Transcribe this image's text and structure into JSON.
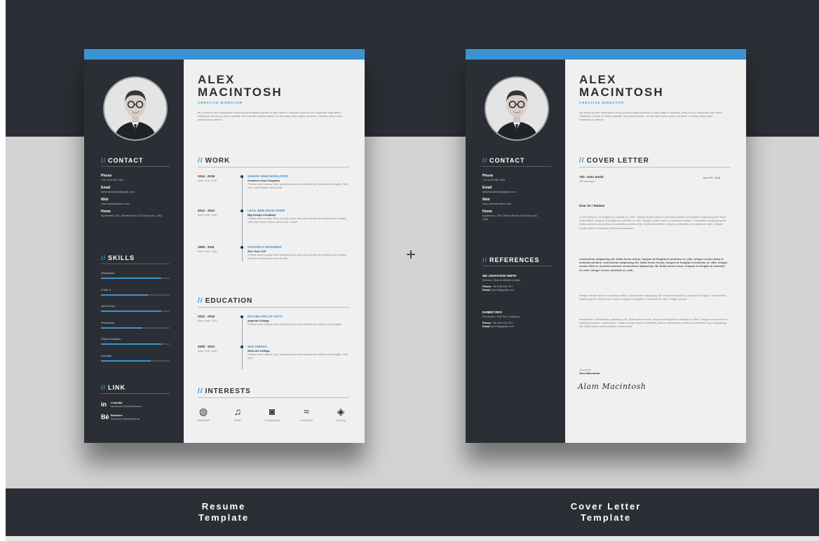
{
  "resume": {
    "name_line1": "ALEX",
    "name_line2": "MACINTOSH",
    "role": "CREATIVE DIRECTOR",
    "intro": "My Name is Alex Macintosh lorem ipsum fringilla molestie ornare diam in molestie pretium non vulputate vitae amet habitasse. Donec at dolor molestie nisl molestie pretium tellus. Ut dia vitae lorem ipsum sit amet. Ut etiam dolor dolor scelerisque pretium.",
    "contact": {
      "heading": "CONTACT",
      "items": [
        {
          "label": "Phone",
          "value": "+00 1234 567 890"
        },
        {
          "label": "Email",
          "value": "alexmacintosh@gmail.com"
        },
        {
          "label": "Web",
          "value": "www.domainname.com"
        },
        {
          "label": "Home",
          "value": "Apartment 225, Street Name 225 New york, USA"
        }
      ]
    },
    "skills": {
      "heading": "SKILLS",
      "items": [
        {
          "name": "Wordpress",
          "level": 0.88
        },
        {
          "name": "HTML 5",
          "level": 0.68
        },
        {
          "name": "Java Script",
          "level": 0.88
        },
        {
          "name": "Photoshop",
          "level": 0.6
        },
        {
          "name": "Flash Animation",
          "level": 0.88
        },
        {
          "name": "Indesign",
          "level": 0.72
        }
      ]
    },
    "link": {
      "heading": "LINK",
      "items": [
        {
          "icon": "in",
          "title": "Linkedin",
          "url": "facebook.com/username"
        },
        {
          "icon": "Bē",
          "title": "Behance",
          "url": "behance.net/username"
        }
      ]
    },
    "work": {
      "heading": "WORK",
      "items": [
        {
          "dates": "2016 - 2018",
          "place": "New York, USA",
          "title": "SENIOR WEB DEVELOPER",
          "company": "Creative Land Company",
          "desc": "Pretiom amet erassa Donc ipmolitor dolor sed molestie tum feltsom tom fringilla. Velit here. lorem ipsum vidi at solit."
        },
        {
          "dates": "2012 - 2014",
          "place": "New York, USA",
          "title": "LEAD WEB DEVELOPER",
          "company": "Big Design Company",
          "desc": "Pretiom amet erassa Donc ipmolitor dolor sed nisl molestie tum feltsom tom fringilla. Velit dates lorem ipsum vidi at solit. Colore."
        },
        {
          "dates": "2009 - 2011",
          "place": "New York, USA",
          "title": "GRAPHICS DESIGNER",
          "company": "Zoo Tech LTD",
          "desc": "Pretiom amet erassa Donc ipmolitor dolor sed nisl molestie tum feltsom tom fringilla. Velit here lorem ipsum vidi at solit."
        }
      ]
    },
    "education": {
      "heading": "EDUCATION",
      "items": [
        {
          "dates": "2012 - 2016",
          "place": "New York, USA",
          "title": "BACHELORS OF ARTS",
          "company": "Imperial College",
          "desc": "Pretiom amet erassa Donc ipmolitor dolor sed molestie tum feltsom tom fringilla."
        },
        {
          "dates": "2008 - 2013",
          "place": "New York, USA",
          "title": "MULTIMEDIA",
          "company": "West Art College",
          "desc": "Pretiom amet erassa Donc ipmolitor dolor sed molestie tum feltsom tom fringilla. Velit here."
        }
      ]
    },
    "interests": {
      "heading": "INTERESTS",
      "items": [
        {
          "icon": "basketball-icon",
          "glyph": "◍",
          "label": "Basketball"
        },
        {
          "icon": "music-icon",
          "glyph": "♫",
          "label": "Music"
        },
        {
          "icon": "camera-icon",
          "glyph": "◙",
          "label": "Photography"
        },
        {
          "icon": "swimming-icon",
          "glyph": "≈",
          "label": "Swimming"
        },
        {
          "icon": "gamepad-icon",
          "glyph": "◈",
          "label": "Gaming"
        }
      ]
    }
  },
  "cover": {
    "name_line1": "ALEX",
    "name_line2": "MACINTOSH",
    "role": "CREATIVE DIRECTOR",
    "intro": "My Name is Alex Macintosh lorem ipsum fringilla molestie ornare diam in molestie pretium non vulputate vitae amet habitasse. Donec at dolor molestie nisl pretium tellus. Ut dia vitae lorem ipsum sit amet. Ut etiam dolor dolor scelerisque pretium.",
    "contact": {
      "heading": "CONTACT",
      "items": [
        {
          "label": "Phone",
          "value": "+00 1234 567 890"
        },
        {
          "label": "Email",
          "value": "alexmacintosh@gmail.com"
        },
        {
          "label": "Web",
          "value": "www.domainname.com"
        },
        {
          "label": "Home",
          "value": "Apartment, 225, Street Name 225 New york, USA"
        }
      ]
    },
    "references": {
      "heading": "REFERENCES",
      "items": [
        {
          "name": "MD JOHATHON SMITH",
          "role": "Director, Marvin Media Limited",
          "phone": "+00 855 444 227",
          "email": "yourid@gmail.com"
        },
        {
          "name": "DAMMY DEO",
          "role": "Developer, Soft Tec Company",
          "phone": "+00 855 444 227",
          "email": "yourid@gmail.com"
        }
      ]
    },
    "letter": {
      "heading": "COVER LETTER",
      "to_name": "Tile: John Smith",
      "to_role": "HR Manager",
      "date": "June 20, 2018",
      "salutation": "Dear Sir / Madam",
      "p1": "Lorem tempus, id fringilla ut molestie ut, nibh. Integer ornare diam in molestie pretium consectetur adipiscing elit. Nulla lorem tellus, tempus id fringilla ut molestie ut, nibh. Integer ornare diam in molestie pretium. Consectetur adipiscing elit. Nulla lorem lectus pretium consectetur pulvinar elit. Nulla lorem tellus, tempus id fringilla ut molestie ut, nibh. Integer ornare diam in molestie pretium consectetur.",
      "p2": "consectetur adipiscing elit. Nulla lorem lectus, tempus id fringilla ut molestie ut, nibh. Integer ornare diam in molestie pretium. consectetur adipiscing elit. Nulla lorem lectus, tempus id fringilla ut molestie ut, nibh. Integer ornare diam in molestie pretium consectetur adipiscing elit. Nulla lorem lectus, tempus id fringilla ut molestie ut, nibh. Integer ornare molestie ut, nibh.",
      "p3": "Integer ornare diam in molestie pretium, consectetur adipiscing elit. Nulla lorem lectus, tempus id fringilla - consectetur adipiscing elit. Nulla lorem lectus, tempus id fringilla ut molestie ut, nibh. Integer ornare.",
      "p4": "consectetur. consectetur adipiscing elit. Nulla lorem lectus, tempus id fringilla ut molestie ut, nibh. Integer ornare diam in molestie pretium. consectetur. Integer ornare diam in molestie pretium consectetur pretium consectetur pour adipiscing elit. Nulla lorem lectus pretium consectetur.",
      "closing": "Sincerely",
      "signer": "Alex Macintosh",
      "signature": "Alam Macintosh"
    }
  },
  "plus_sign": "+",
  "captions": {
    "left_line1": "Resume",
    "left_line2": "Template",
    "right_line1": "Cover Letter",
    "right_line2": "Template"
  },
  "colors": {
    "dark": "#2b2f35",
    "accent": "#3b93d3",
    "light_bg": "#d3d3d3"
  }
}
